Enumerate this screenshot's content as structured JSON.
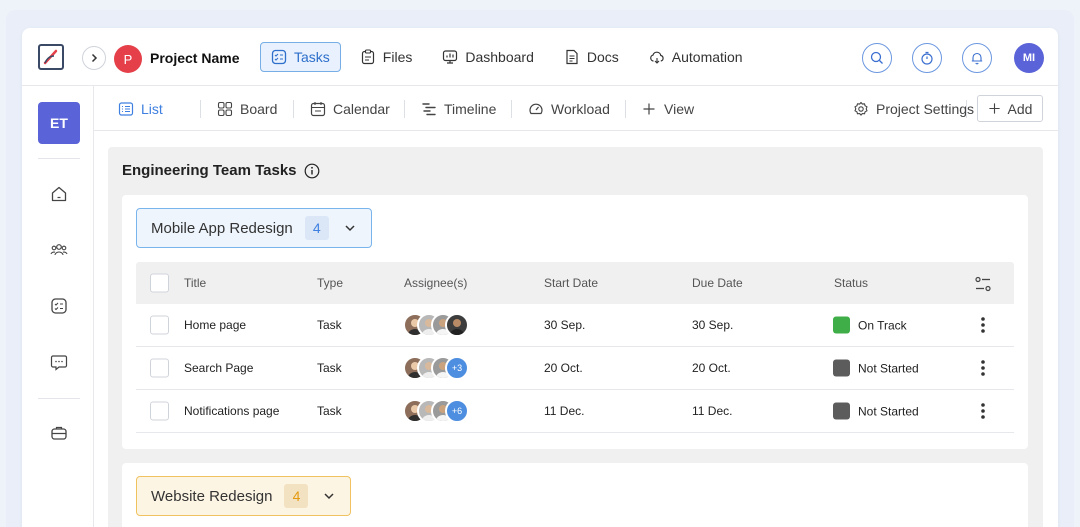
{
  "header": {
    "project_avatar_letter": "P",
    "project_name": "Project Name",
    "nav": [
      {
        "label": "Tasks",
        "icon": "tasks-icon"
      },
      {
        "label": "Files",
        "icon": "clipboard-icon"
      },
      {
        "label": "Dashboard",
        "icon": "dashboard-icon"
      },
      {
        "label": "Docs",
        "icon": "document-icon"
      },
      {
        "label": "Automation",
        "icon": "cloud-icon"
      }
    ],
    "active_nav": "Tasks",
    "user_initials": "MI"
  },
  "sidebar": {
    "workspace_initials": "ET",
    "items": [
      "home-icon",
      "team-icon",
      "tasks-icon",
      "chat-icon",
      "briefcase-icon"
    ]
  },
  "viewbar": {
    "views": [
      {
        "label": "List",
        "icon": "list-icon"
      },
      {
        "label": "Board",
        "icon": "board-icon"
      },
      {
        "label": "Calendar",
        "icon": "calendar-icon"
      },
      {
        "label": "Timeline",
        "icon": "timeline-icon"
      },
      {
        "label": "Workload",
        "icon": "workload-icon"
      },
      {
        "label": "View",
        "icon": "plus-icon"
      }
    ],
    "active_view": "List",
    "settings_label": "Project Settings",
    "add_label": "Add"
  },
  "main": {
    "section_title": "Engineering Team Tasks",
    "columns": [
      "Title",
      "Type",
      "Assignee(s)",
      "Start Date",
      "Due Date",
      "Status"
    ],
    "groups": [
      {
        "name": "Mobile App Redesign",
        "count": "4",
        "tasks": [
          {
            "title": "Home page",
            "type": "Task",
            "assignee_extra": "",
            "start": "30 Sep.",
            "due": "30 Sep.",
            "status": "On Track",
            "status_color": "#3fae49"
          },
          {
            "title": "Search Page",
            "type": "Task",
            "assignee_extra": "+3",
            "start": "20 Oct.",
            "due": "20 Oct.",
            "status": "Not Started",
            "status_color": "#5c5c5c"
          },
          {
            "title": "Notifications page",
            "type": "Task",
            "assignee_extra": "+6",
            "start": "11 Dec.",
            "due": "11 Dec.",
            "status": "Not Started",
            "status_color": "#5c5c5c"
          }
        ]
      },
      {
        "name": "Website Redesign",
        "count": "4"
      }
    ]
  },
  "colors": {
    "accent": "#5a63d8",
    "link_blue": "#3e7fe0",
    "on_track": "#3fae49",
    "not_started": "#5c5c5c",
    "project_avatar": "#e5404a"
  }
}
